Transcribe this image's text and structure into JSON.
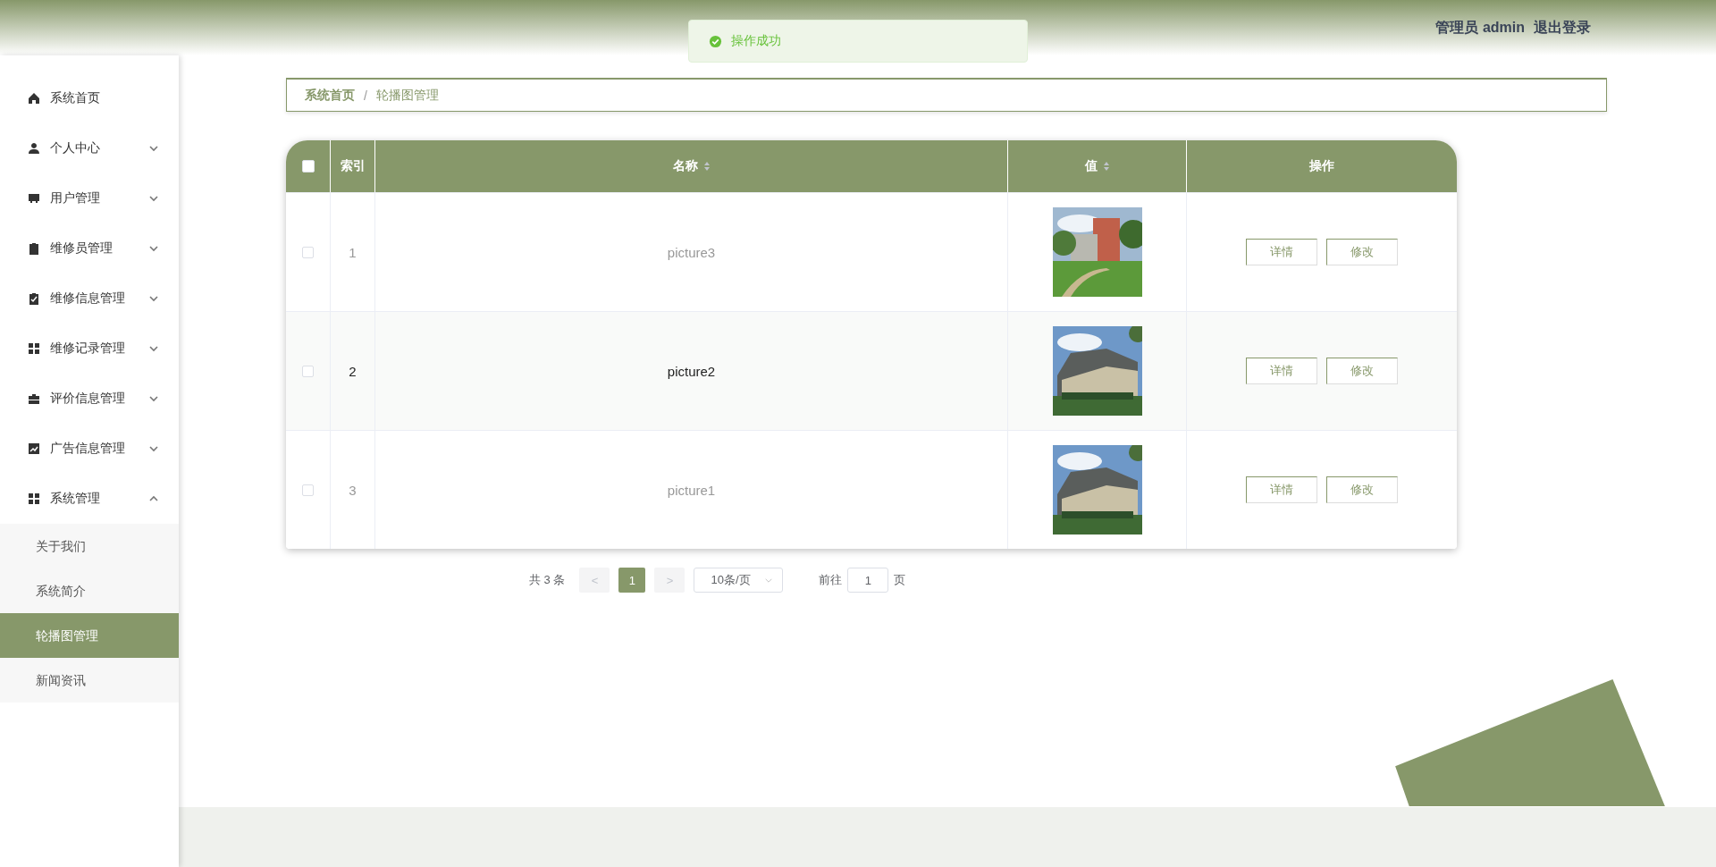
{
  "header": {
    "user_label": "管理员 admin",
    "logout": "退出登录"
  },
  "toast": {
    "message": "操作成功"
  },
  "sidebar": {
    "items": [
      {
        "label": "系统首页"
      },
      {
        "label": "个人中心",
        "expanded": false
      },
      {
        "label": "用户管理",
        "expanded": false
      },
      {
        "label": "维修员管理",
        "expanded": false
      },
      {
        "label": "维修信息管理",
        "expanded": false
      },
      {
        "label": "维修记录管理",
        "expanded": false
      },
      {
        "label": "评价信息管理",
        "expanded": false
      },
      {
        "label": "广告信息管理",
        "expanded": false
      },
      {
        "label": "系统管理",
        "expanded": true,
        "children": [
          {
            "label": "关于我们",
            "selected": false
          },
          {
            "label": "系统简介",
            "selected": false
          },
          {
            "label": "轮播图管理",
            "selected": true
          },
          {
            "label": "新闻资讯",
            "selected": false
          }
        ]
      }
    ]
  },
  "breadcrumb": [
    "系统首页",
    "/",
    "轮播图管理"
  ],
  "table": {
    "select_all": false,
    "columns": [
      {
        "label": "索引",
        "sortable": false
      },
      {
        "label": "名称",
        "sortable": true
      },
      {
        "label": "值",
        "sortable": true
      },
      {
        "label": "操作",
        "sortable": false
      }
    ],
    "rows": [
      {
        "checked": false,
        "highlighted": false,
        "index": "1",
        "name": "picture3",
        "value": {
          "kind": "picture"
        },
        "actions": [
          "详情",
          "修改"
        ]
      },
      {
        "checked": false,
        "highlighted": true,
        "index": "2",
        "name": "picture2",
        "value": {
          "kind": "picture"
        },
        "actions": [
          "详情",
          "修改"
        ]
      },
      {
        "checked": false,
        "highlighted": false,
        "index": "3",
        "name": "picture1",
        "value": {
          "kind": "picture"
        },
        "actions": [
          "详情",
          "修改"
        ]
      }
    ]
  },
  "pagination": {
    "total": "共 3 条",
    "prev": "<",
    "pages": [
      {
        "label": "1",
        "selected": true
      }
    ],
    "next": ">",
    "page_size": "10条/页",
    "goto_label": "前往",
    "goto_value": "1",
    "goto_suffix": "页"
  }
}
